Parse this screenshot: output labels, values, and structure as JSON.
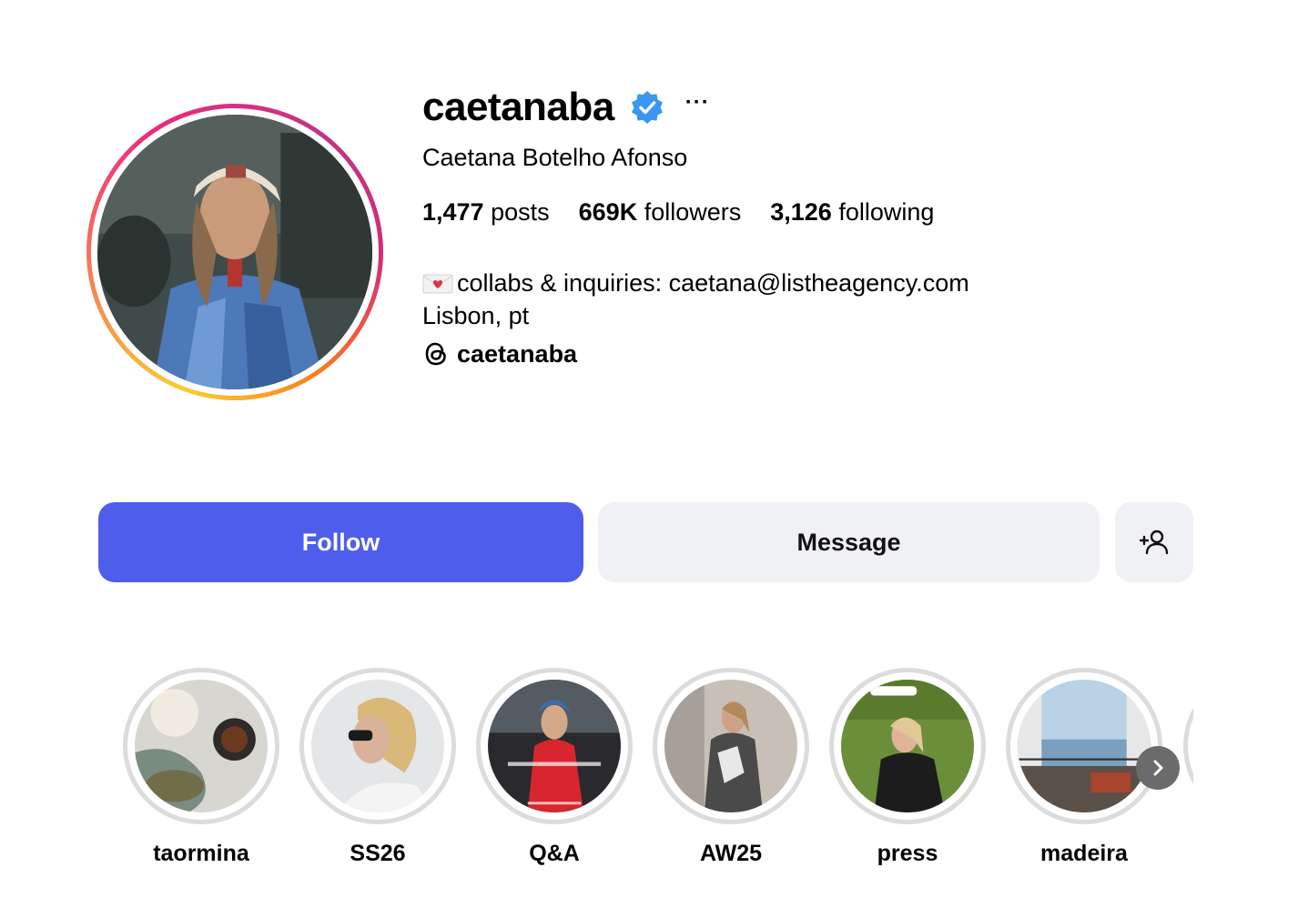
{
  "profile": {
    "username": "caetanaba",
    "verified_icon": "verified-badge-icon",
    "more_label": "···",
    "full_name": "Caetana Botelho Afonso",
    "stats": {
      "posts_count": "1,477",
      "posts_label": "posts",
      "followers_count": "669K",
      "followers_label": "followers",
      "following_count": "3,126",
      "following_label": "following"
    },
    "bio": {
      "line1": "collabs & inquiries: caetana@listheagency.com",
      "line2": "Lisbon, pt",
      "threads_handle": "caetanaba"
    }
  },
  "actions": {
    "follow_label": "Follow",
    "message_label": "Message",
    "add_user_icon": "add-user-icon"
  },
  "highlights": [
    {
      "label": "taormina"
    },
    {
      "label": "SS26"
    },
    {
      "label": "Q&A"
    },
    {
      "label": "AW25"
    },
    {
      "label": "press"
    },
    {
      "label": "madeira"
    }
  ],
  "colors": {
    "follow_button": "#4f5ded",
    "secondary_button": "#eff1f4",
    "verified_blue": "#3897f0"
  }
}
